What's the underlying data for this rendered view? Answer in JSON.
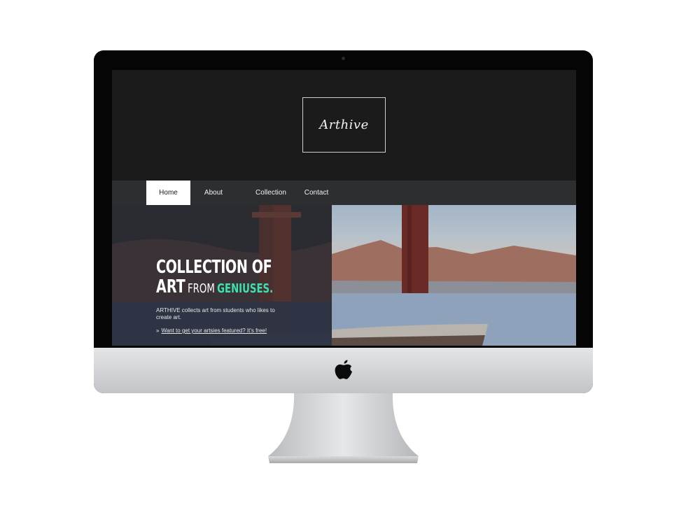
{
  "site": {
    "logo_text": "Arthive"
  },
  "nav": {
    "items": [
      {
        "label": "Home",
        "active": true
      },
      {
        "label": "About",
        "active": false
      },
      {
        "label": "Collection",
        "active": false
      },
      {
        "label": "Contact",
        "active": false
      }
    ]
  },
  "hero": {
    "headline_line1": "COLLECTION OF",
    "headline_art": "ART",
    "headline_from": "FROM",
    "headline_geniuses": "GENIUSES.",
    "tagline": "ARTHIVE collects art from students who likes to create art.",
    "cta_marker": "»",
    "cta_label": "Want to get your artsies featured? It's free!"
  },
  "colors": {
    "accent": "#3fe0b0",
    "screen_bg": "#1b1b1b",
    "navbar_bg": "#2d2e2f",
    "caption_bg": "#2e3444"
  },
  "icons": {
    "device_logo": "apple-logo-icon"
  }
}
